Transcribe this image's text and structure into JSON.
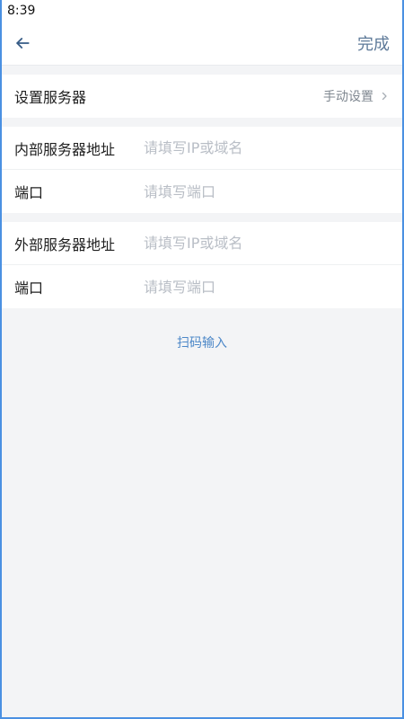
{
  "status_bar": {
    "time": "8:39"
  },
  "nav": {
    "back_icon": "arrow-left-icon",
    "done_label": "完成"
  },
  "server_setting": {
    "label": "设置服务器",
    "value": "手动设置",
    "chevron_icon": "chevron-right-icon"
  },
  "internal": {
    "address_label": "内部服务器地址",
    "address_value": "",
    "address_placeholder": "请填写IP或域名",
    "port_label": "端口",
    "port_value": "",
    "port_placeholder": "请填写端口"
  },
  "external": {
    "address_label": "外部服务器地址",
    "address_value": "",
    "address_placeholder": "请填写IP或域名",
    "port_label": "端口",
    "port_value": "",
    "port_placeholder": "请填写端口"
  },
  "scan": {
    "label": "扫码输入"
  },
  "colors": {
    "accent": "#4d88c8",
    "done": "#5e7a99",
    "background": "#f3f4f6",
    "frame": "#4a90e2"
  }
}
